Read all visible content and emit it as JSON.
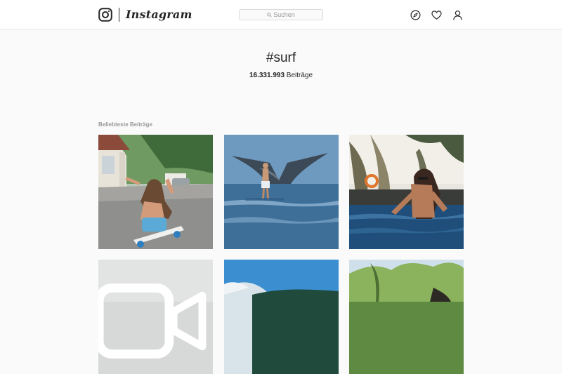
{
  "header": {
    "brand": "Instagram",
    "search_placeholder": "Suchen",
    "icons": [
      "instagram-camera-icon",
      "compass-icon",
      "heart-icon",
      "profile-icon"
    ]
  },
  "hashtag": {
    "title": "#surf",
    "count": "16.331.993",
    "count_label": "Beiträge"
  },
  "section": {
    "title": "Beliebteste Beiträge"
  },
  "posts": [
    {
      "kind": "photo"
    },
    {
      "kind": "photo"
    },
    {
      "kind": "photo"
    },
    {
      "kind": "video"
    },
    {
      "kind": "photo"
    },
    {
      "kind": "photo"
    }
  ],
  "colors": {
    "background": "#fafafa",
    "text": "#262626",
    "muted": "#999999",
    "border": "#dbdbdb"
  }
}
